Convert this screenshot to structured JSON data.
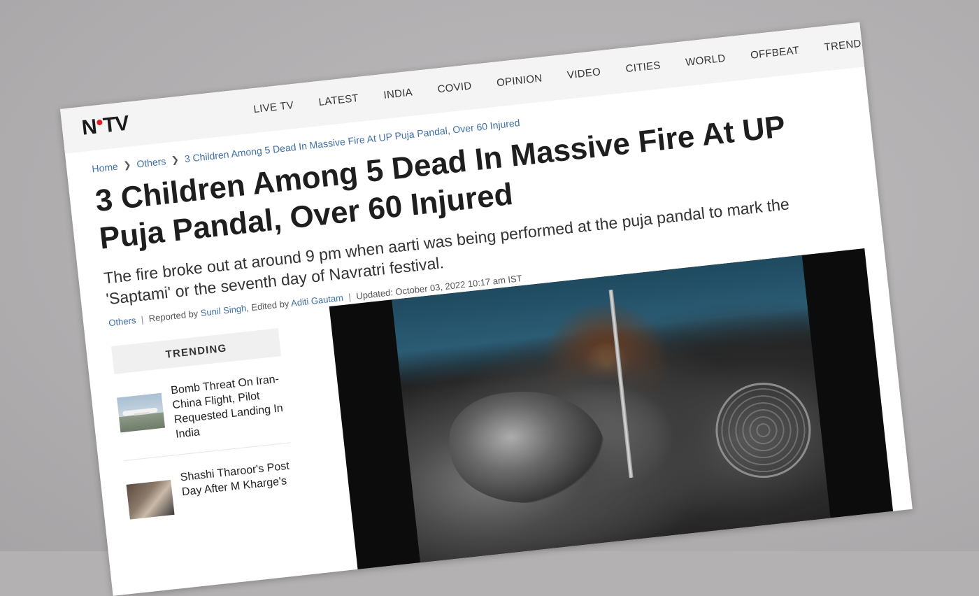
{
  "site": {
    "logo_text_left": "N",
    "logo_text_right": "TV",
    "brand_accent": "#e41b23"
  },
  "nav": {
    "items": [
      "LIVE TV",
      "LATEST",
      "INDIA",
      "COVID",
      "OPINION",
      "VIDEO",
      "CITIES",
      "WORLD",
      "OFFBEAT",
      "TRENDS"
    ]
  },
  "breadcrumb": {
    "home": "Home",
    "section": "Others",
    "current": "3 Children Among 5 Dead In Massive Fire At UP Puja Pandal, Over 60 Injured",
    "separator_icon": "chevron-right-icon"
  },
  "article": {
    "headline": "3 Children Among 5 Dead In Massive Fire At UP Puja Pandal, Over 60 Injured",
    "summary": "The fire broke out at around 9 pm when aarti was being performed at the puja pandal to mark the 'Saptami' or the seventh day of Navratri festival.",
    "byline": {
      "category": "Others",
      "reported_by_label": "Reported by",
      "reporter": "Sunil Singh",
      "edited_by_label": ", Edited by",
      "editor": "Aditi Gautam",
      "updated": "Updated: October 03, 2022 10:17 am IST"
    }
  },
  "trending": {
    "header": "TRENDING",
    "items": [
      {
        "title": "Bomb Threat On Iran-China Flight, Pilot Requested Landing In India",
        "thumb_icon": "airplane-photo"
      },
      {
        "title": "Shashi Tharoor's Post Day After M Kharge's",
        "thumb_icon": "people-photo"
      }
    ]
  }
}
